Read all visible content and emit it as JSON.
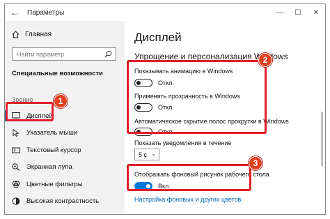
{
  "window": {
    "title": "Параметры",
    "back_icon": "arrow-left-icon",
    "controls": {
      "minimize": "—",
      "maximize": "☐",
      "close": "✕"
    }
  },
  "sidebar": {
    "home_label": "Главная",
    "search_placeholder": "Найти параметр",
    "section_title": "Специальные возможности",
    "group_title": "Зрение",
    "items": [
      {
        "label": "Дисплей",
        "icon": "display-icon",
        "active": true
      },
      {
        "label": "Указатель мыши",
        "icon": "mouse-pointer-icon",
        "active": false
      },
      {
        "label": "Текстовый курсор",
        "icon": "text-cursor-icon",
        "active": false
      },
      {
        "label": "Экранная лупа",
        "icon": "magnifier-icon",
        "active": false
      },
      {
        "label": "Цветные фильтры",
        "icon": "color-filter-icon",
        "active": false
      },
      {
        "label": "Высокая контрастность",
        "icon": "contrast-icon",
        "active": false
      }
    ]
  },
  "main": {
    "page_title": "Дисплей",
    "section_title": "Упрощение и персонализация Windows",
    "settings": [
      {
        "label": "Показывать анимацию в Windows",
        "state_text": "Откл.",
        "on": false
      },
      {
        "label": "Применять прозрачность в Windows",
        "state_text": "Откл.",
        "on": false
      },
      {
        "label": "Автоматическое скрытие полос прокрутки в Windows",
        "state_text": "Откл.",
        "on": false
      }
    ],
    "notifications": {
      "label": "Показать уведомления в течение",
      "value": "5 с"
    },
    "background": {
      "label": "Отображать фоновый рисунок рабочего стола",
      "state_text": "Вкл.",
      "on": true
    },
    "link": "Настройка фоновых и других цветов"
  },
  "callouts": [
    "1",
    "2",
    "3"
  ],
  "colors": {
    "accent": "#0078d7",
    "highlight": "#e11d2a",
    "callout": "#e2401f",
    "sidebar_bg": "#f2f2f2"
  }
}
